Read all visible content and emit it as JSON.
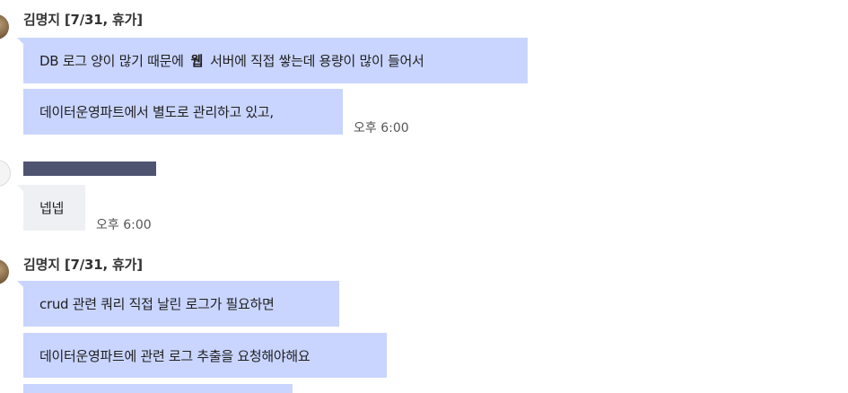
{
  "messages": [
    {
      "sender": "김명지 [7/31, 휴가]",
      "lines": [
        {
          "pre": "DB 로그 양이 많기 때문에",
          "emphasis": "웹",
          "post": "서버에 직접 쌓는데 용량이 많이 들어서"
        },
        {
          "text": "데이터운영파트에서 별도로 관리하고 있고,"
        }
      ],
      "time": "오후 6:00"
    },
    {
      "lines": [
        {
          "text": "넵넵"
        }
      ],
      "time": "오후 6:00"
    },
    {
      "sender": "김명지 [7/31, 휴가]",
      "lines": [
        {
          "text": "crud 관련 쿼리 직접 날린 로그가 필요하면"
        },
        {
          "text": "데이터운영파트에 관련 로그 추출을 요청해야해요"
        }
      ]
    }
  ]
}
